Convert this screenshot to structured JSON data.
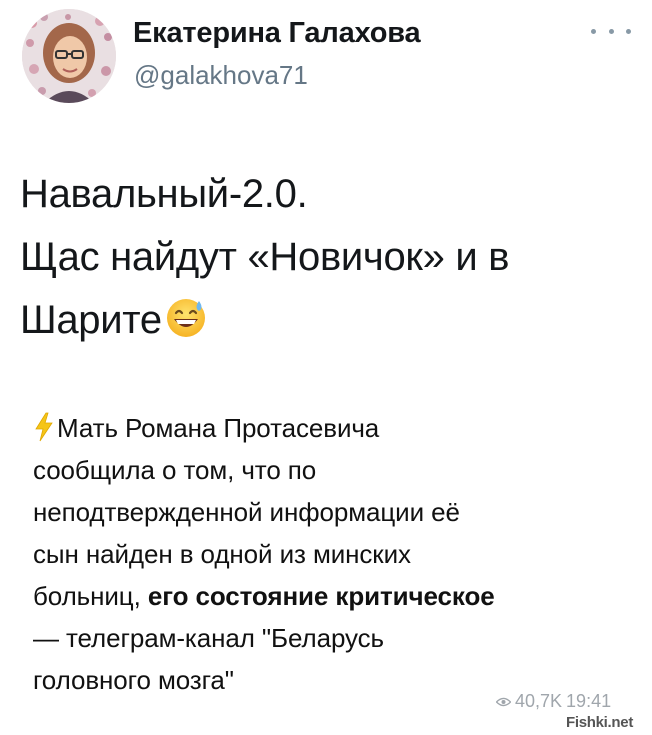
{
  "author": {
    "name": "Екатерина Галахова",
    "handle": "@galakhova71"
  },
  "tweet": {
    "lines": [
      "Навальный-2.0.",
      "Щас найдут «Новичок» и в",
      "Шарите"
    ],
    "emoji": "grinning-face-with-sweat"
  },
  "quoted": {
    "line1": "Мать Романа Протасевича",
    "line2": "сообщила о том, что по",
    "line3": "неподтвержденной информации её",
    "line4": "сын найден в одной из минских",
    "line5_plain": "больниц, ",
    "line5_bold": "его состояние критическое",
    "line6": "— телеграм-канал \"Беларусь",
    "line7": "головного мозга\"",
    "views": "40,7K",
    "time": "19:41"
  },
  "watermark": "Fishki.net",
  "colors": {
    "text": "#14171a",
    "handle": "#657786",
    "meta": "#a0a6ac",
    "bolt": "#f5c518"
  }
}
